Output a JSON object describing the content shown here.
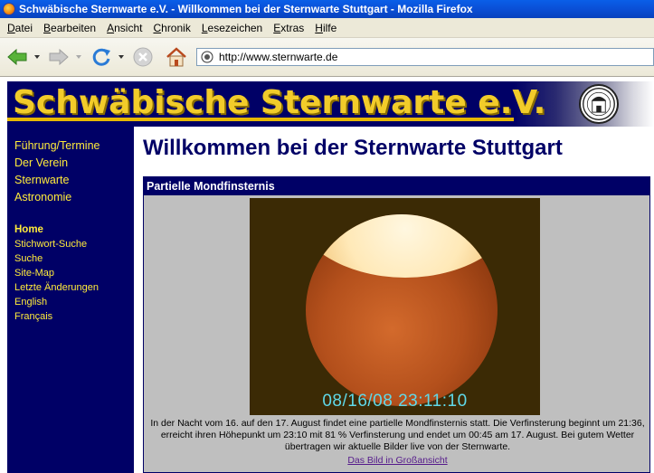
{
  "window": {
    "title": "Schwäbische Sternwarte e.V. - Willkommen bei der Sternwarte Stuttgart - Mozilla Firefox"
  },
  "menubar": {
    "items": [
      "Datei",
      "Bearbeiten",
      "Ansicht",
      "Chronik",
      "Lesezeichen",
      "Extras",
      "Hilfe"
    ]
  },
  "toolbar": {
    "icons": [
      "back-arrow-icon",
      "forward-arrow-icon",
      "reload-icon",
      "stop-icon",
      "home-icon"
    ],
    "url": "http://www.sternwarte.de"
  },
  "banner": {
    "logo_text": "Schwäbische Sternwarte e.V."
  },
  "sidebar": {
    "main_links": [
      "Führung/Termine",
      "Der Verein",
      "Sternwarte",
      "Astronomie"
    ],
    "home": "Home",
    "sub_links": [
      "Stichwort-Suche",
      "Suche",
      "Site-Map",
      "Letzte Änderungen",
      "English",
      "Français"
    ]
  },
  "content": {
    "heading": "Willkommen bei der Sternwarte Stuttgart",
    "box_title": "Partielle Mondfinsternis",
    "photo_timestamp": "08/16/08 23:11:10",
    "caption": "In der Nacht vom 16. auf den 17. August findet eine partielle Mondfinsternis statt. Die Verfinsterung beginnt um 21:36, erreicht ihren Höhepunkt um 23:10 mit 81 % Verfinsterung und endet um 00:45 am 17. August. Bei gutem Wetter übertragen wir aktuelle Bilder live von der Sternwarte.",
    "link": "Das Bild in Großansicht"
  },
  "colors": {
    "titlebar": "#0a4fd6",
    "navy": "#000066",
    "gold": "#f2cc2a",
    "link_yellow": "#ffeb3b"
  }
}
